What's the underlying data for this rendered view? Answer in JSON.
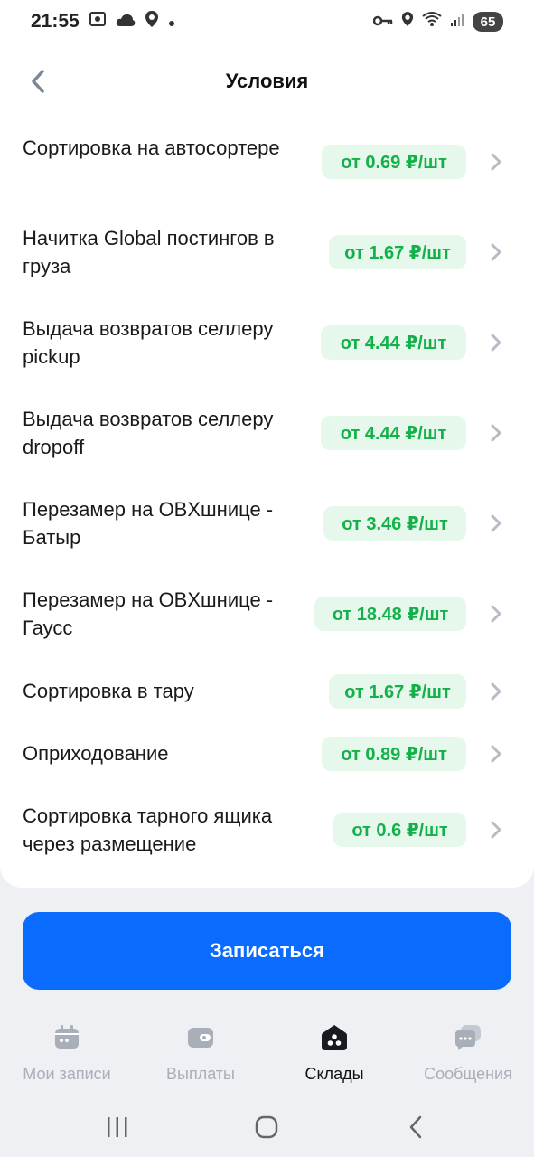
{
  "status": {
    "time": "21:55",
    "battery": "65"
  },
  "header": {
    "title": "Условия"
  },
  "items": [
    {
      "label": "Сортировка на автосортере",
      "price": "от 0.69 ₽/шт"
    },
    {
      "label": "Начитка Global постингов в груза",
      "price": "от 1.67 ₽/шт"
    },
    {
      "label": "Выдача возвратов селлеру pickup",
      "price": "от 4.44 ₽/шт"
    },
    {
      "label": "Выдача возвратов селлеру dropoff",
      "price": "от 4.44 ₽/шт"
    },
    {
      "label": "Перезамер на OBXшнице - Батыр",
      "price": "от 3.46 ₽/шт"
    },
    {
      "label": "Перезамер на OBXшнице - Гаусс",
      "price": "от 18.48 ₽/шт"
    },
    {
      "label": "Сортировка в тару",
      "price": "от 1.67 ₽/шт"
    },
    {
      "label": "Оприходование",
      "price": "от 0.89 ₽/шт"
    },
    {
      "label": "Сортировка тарного ящика через размещение",
      "price": "от 0.6 ₽/шт"
    }
  ],
  "cta": {
    "label": "Записаться"
  },
  "tabs": [
    {
      "label": "Мои записи",
      "icon": "calendar-icon"
    },
    {
      "label": "Выплаты",
      "icon": "wallet-icon"
    },
    {
      "label": "Склады",
      "icon": "warehouse-icon",
      "active": true
    },
    {
      "label": "Сообщения",
      "icon": "messages-icon"
    }
  ],
  "colors": {
    "accent": "#0a6cff",
    "price_text": "#14b14a",
    "price_bg": "#e6f8ec"
  }
}
